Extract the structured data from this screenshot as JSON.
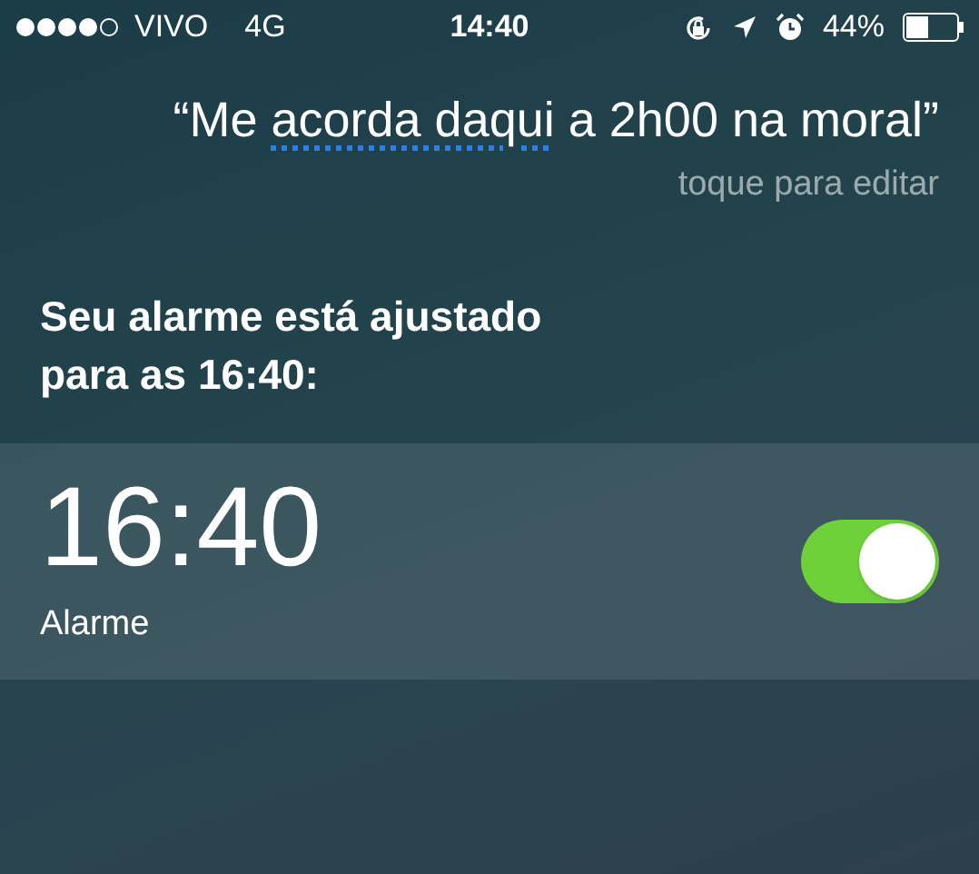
{
  "status_bar": {
    "carrier": "VIVO",
    "network": "4G",
    "time": "14:40",
    "battery": "44%"
  },
  "query": {
    "segments": [
      {
        "text": "“Me ",
        "flagged": false
      },
      {
        "text": "acorda daqui",
        "flagged": true
      },
      {
        "text": " a 2h00 na moral”",
        "flagged": false
      }
    ],
    "hint": "toque para editar"
  },
  "response": "Seu alarme está ajustado para as 16:40:",
  "alarm": {
    "time": "16:40",
    "label": "Alarme",
    "on": true
  }
}
